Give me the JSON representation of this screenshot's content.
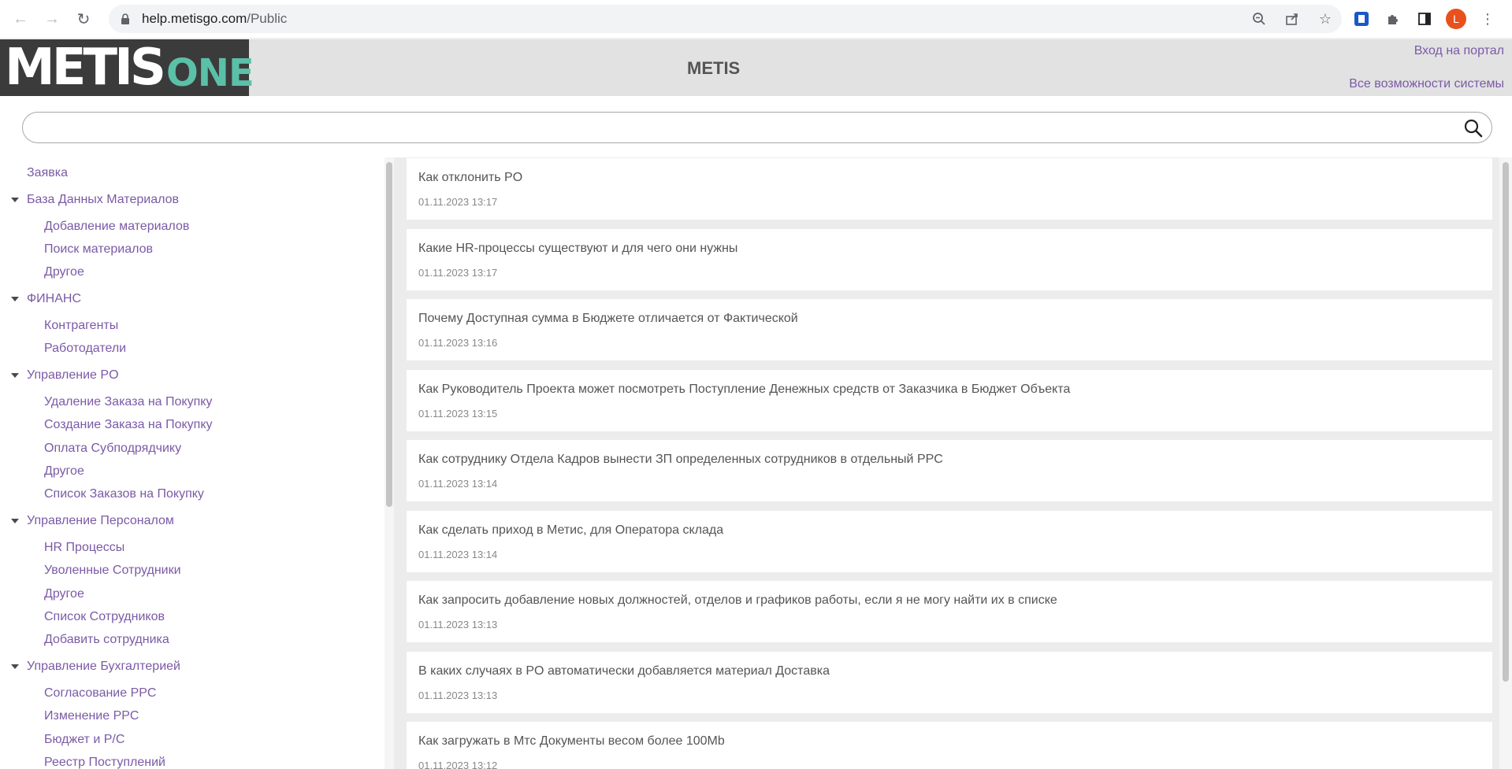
{
  "browser": {
    "url_host": "help.metisgo.com",
    "url_path": "/Public",
    "avatar_letter": "L"
  },
  "header": {
    "logo_main": "METIS",
    "logo_sub": "ONE",
    "title": "METIS",
    "portal_link": "Вход на портал",
    "features_link": "Все возможности системы"
  },
  "search": {
    "placeholder": "",
    "value": ""
  },
  "sidebar": {
    "items": [
      {
        "label": "Заявка",
        "level": "top"
      },
      {
        "label": "База Данных Материалов",
        "level": "cat"
      },
      {
        "label": "Добавление материалов",
        "level": "sub"
      },
      {
        "label": "Поиск материалов",
        "level": "sub"
      },
      {
        "label": "Другое",
        "level": "sub"
      },
      {
        "label": "ФИНАНС",
        "level": "cat"
      },
      {
        "label": "Контрагенты",
        "level": "sub"
      },
      {
        "label": "Работодатели",
        "level": "sub"
      },
      {
        "label": "Управление PO",
        "level": "cat"
      },
      {
        "label": "Удаление Заказа на Покупку",
        "level": "sub"
      },
      {
        "label": "Создание Заказа на Покупку",
        "level": "sub"
      },
      {
        "label": "Оплата Субподрядчику",
        "level": "sub"
      },
      {
        "label": "Другое",
        "level": "sub"
      },
      {
        "label": "Список Заказов на Покупку",
        "level": "sub"
      },
      {
        "label": "Управление Персоналом",
        "level": "cat"
      },
      {
        "label": "HR Процессы",
        "level": "sub"
      },
      {
        "label": "Уволенные Сотрудники",
        "level": "sub"
      },
      {
        "label": "Другое",
        "level": "sub"
      },
      {
        "label": "Список Сотрудников",
        "level": "sub"
      },
      {
        "label": "Добавить сотрудника",
        "level": "sub"
      },
      {
        "label": "Управление Бухгалтерией",
        "level": "cat"
      },
      {
        "label": "Согласование PPC",
        "level": "sub"
      },
      {
        "label": "Изменение PPC",
        "level": "sub"
      },
      {
        "label": "Бюджет и P/C",
        "level": "sub"
      },
      {
        "label": "Реестр Поступлений",
        "level": "sub"
      }
    ]
  },
  "articles": [
    {
      "title": "Как отклонить PO",
      "date": "01.11.2023 13:17"
    },
    {
      "title": "Какие HR-процессы существуют и для чего они нужны",
      "date": "01.11.2023 13:17"
    },
    {
      "title": "Почему Доступная сумма в Бюджете отличается от Фактической",
      "date": "01.11.2023 13:16"
    },
    {
      "title": "Как Руководитель Проекта может посмотреть Поступление Денежных средств от Заказчика в Бюджет Объекта",
      "date": "01.11.2023 13:15"
    },
    {
      "title": "Как сотруднику Отдела Кадров вынести ЗП определенных сотрудников в отдельный PPC",
      "date": "01.11.2023 13:14"
    },
    {
      "title": "Как сделать приход в Метис, для Оператора склада",
      "date": "01.11.2023 13:14"
    },
    {
      "title": "Как запросить добавление новых должностей, отделов и графиков работы, если я не могу найти их в списке",
      "date": "01.11.2023 13:13"
    },
    {
      "title": "В каких случаях в PO автоматически добавляется материал Доставка",
      "date": "01.11.2023 13:13"
    },
    {
      "title": "Как загружать в Мтс Документы весом более 100Mb",
      "date": "01.11.2023 13:12"
    }
  ]
}
